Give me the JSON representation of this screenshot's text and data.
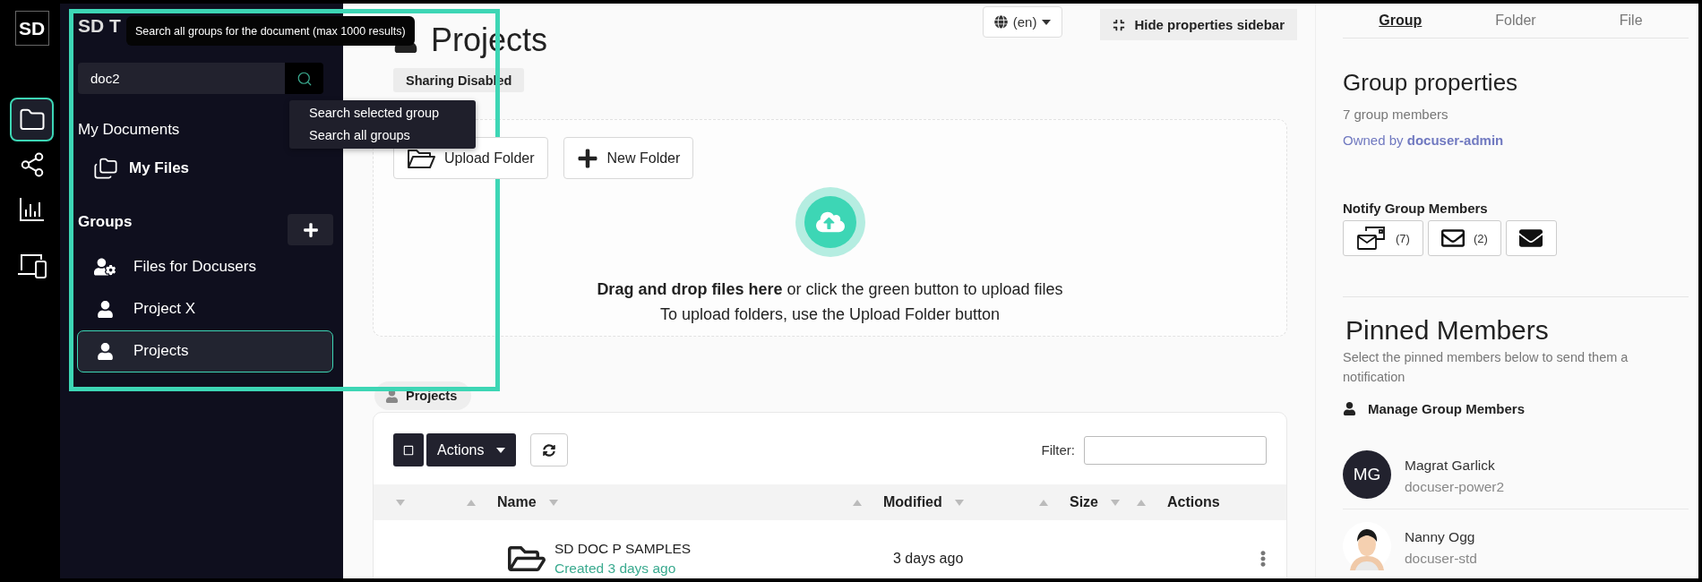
{
  "rail": {
    "logo": "SD",
    "items": [
      {
        "kind": "folder",
        "selected": true
      },
      {
        "kind": "share",
        "selected": false
      },
      {
        "kind": "chart",
        "selected": false
      },
      {
        "kind": "devices",
        "selected": false
      }
    ]
  },
  "sidebar": {
    "title": "SD T",
    "tooltip": "Search all groups for the document (max 1000 results)",
    "search": {
      "value": "doc2"
    },
    "search_menu": [
      "Search selected group",
      "Search all groups"
    ],
    "my_documents": {
      "heading": "My Documents",
      "items": [
        {
          "label": "My Files",
          "selected": false
        }
      ]
    },
    "groups": {
      "heading": "Groups",
      "items": [
        {
          "label": "Files for Docusers",
          "kind": "shared",
          "selected": false
        },
        {
          "label": "Project X",
          "kind": "group",
          "selected": false
        },
        {
          "label": "Projects",
          "kind": "group",
          "selected": true
        }
      ]
    }
  },
  "header": {
    "title": "Projects",
    "badge": "Sharing Disabled",
    "language": "(en)",
    "hide_sidebar": "Hide properties sidebar"
  },
  "dropzone": {
    "buttons": [
      {
        "kind": "upload",
        "label": "Upload Folder"
      },
      {
        "kind": "new",
        "label": "New Folder"
      }
    ],
    "line1": "**Drag and drop files here**  or click the green button to upload files",
    "line2": "To upload folders, use the Upload Folder button"
  },
  "breadcrumb": "Projects",
  "table": {
    "actions_label": "Actions",
    "filter_label": "Filter:",
    "columns": [
      "Name",
      "Modified",
      "Size",
      "Actions"
    ],
    "rows": [
      {
        "name": "SD DOC P SAMPLES",
        "created": "Created 3 days ago",
        "modified": "3 days ago"
      }
    ]
  },
  "properties": {
    "tabs": [
      {
        "label": "Group",
        "selected": true
      },
      {
        "label": "Folder",
        "selected": false
      },
      {
        "label": "File",
        "selected": false
      }
    ],
    "title": "Group properties",
    "members_count": "7 group members",
    "owner": "Owned by **docuser-admin**",
    "notify": {
      "heading": "Notify Group Members",
      "buttons": [
        {
          "kind": "all",
          "count": "(7)"
        },
        {
          "kind": "pinned",
          "count": "(2)"
        },
        {
          "kind": "compose"
        }
      ]
    },
    "pinned": {
      "heading": "Pinned Members",
      "description": "Select the pinned members below to send them a notification",
      "manage": "Manage Group Members",
      "members": [
        {
          "kind": "initials",
          "initials": "MG",
          "name": "Magrat Garlick",
          "username": "docuser-power2"
        },
        {
          "kind": "picture",
          "name": "Nanny Ogg",
          "username": "docuser-std"
        }
      ]
    }
  }
}
